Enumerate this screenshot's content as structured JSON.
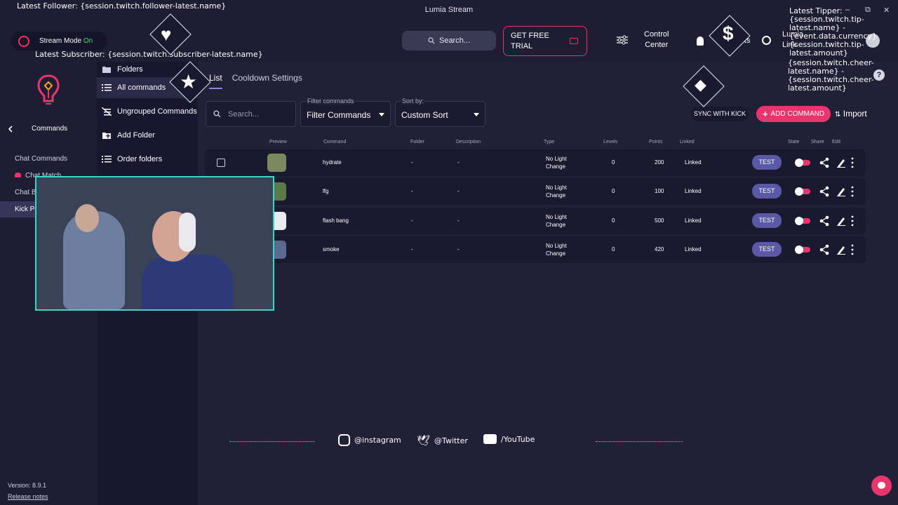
{
  "app": {
    "title": "Lumia Stream",
    "window_controls": [
      "–",
      "⧉",
      "✕"
    ]
  },
  "topbar": {
    "stream_mode_label": "Stream Mode",
    "stream_mode_state": "On",
    "search_label": "Search...",
    "trial_label_1": "GET FREE",
    "trial_label_2": "TRIAL",
    "control_center_1": "Control",
    "control_center_2": "Center",
    "shortcuts": "Shortcuts",
    "lumia_1": "Lumia",
    "lumia_2": "Link"
  },
  "sidebar": {
    "header": "Commands",
    "items": [
      "Chat Commands",
      "Chat Match",
      "Chat Bot Commands",
      "Kick Points"
    ],
    "version": "Version: 8.9.1",
    "release_notes": "Release notes"
  },
  "folders": {
    "items": [
      "Folders",
      "All commands",
      "Ungrouped Commands",
      "Add Folder",
      "Order folders"
    ]
  },
  "tabs": [
    "List",
    "Cooldown Settings"
  ],
  "filters": {
    "search_placeholder": "Search...",
    "filter_label": "Filter commands",
    "filter_value": "Filter Commands",
    "sort_label": "Sort by:",
    "sort_value": "Custom Sort"
  },
  "actions": {
    "sync": "SYNC WITH KICK",
    "add": "ADD COMMAND",
    "import": "Import"
  },
  "table": {
    "headers": [
      "Preview",
      "Command",
      "Folder",
      "Description",
      "Type",
      "Levels",
      "Points",
      "Linked",
      "State",
      "Share",
      "Edit"
    ],
    "rows": [
      {
        "command": "hydrate",
        "folder": "-",
        "description": "-",
        "type_1": "No Light",
        "type_2": "Change",
        "levels": "0",
        "points": "200",
        "linked": "Linked",
        "test": "TEST",
        "thumb_color": "#7a8a5e"
      },
      {
        "command": "lfg",
        "folder": "-",
        "description": "-",
        "type_1": "No Light",
        "type_2": "Change",
        "levels": "0",
        "points": "100",
        "linked": "Linked",
        "test": "TEST",
        "thumb_color": "#5c7a48"
      },
      {
        "command": "flash bang",
        "folder": "-",
        "description": "-",
        "type_1": "No Light",
        "type_2": "Change",
        "levels": "0",
        "points": "500",
        "linked": "Linked",
        "test": "TEST",
        "thumb_color": "#e9ecef"
      },
      {
        "command": "smoke",
        "folder": "-",
        "description": "-",
        "type_1": "No Light",
        "type_2": "Change",
        "levels": "0",
        "points": "420",
        "linked": "Linked",
        "test": "TEST",
        "thumb_color": "#5a6a8e"
      }
    ]
  },
  "overlay": {
    "latest_follower": "Latest Follower: {session.twitch.follower-latest.name}",
    "latest_subscriber": "Latest Subscriber: {session.twitch.subscriber-latest.name}",
    "latest_tipper": "Latest Tipper:",
    "tipper_lines": [
      "{session.twitch.tip-",
      "latest.name} -",
      "{event.data.currency}",
      "{session.twitch.tip-",
      "latest.amount}"
    ],
    "cheer_lines": [
      "{session.twitch.cheer-",
      "latest.name} -",
      "{session.twitch.cheer-",
      "latest.amount}"
    ],
    "instagram": "@instagram",
    "twitter": "@Twitter",
    "youtube": "/YouTube"
  },
  "colors": {
    "accent": "#e8366d",
    "teal": "#36d9c9",
    "bg": "#222037",
    "sidebar": "#1f1d33"
  }
}
